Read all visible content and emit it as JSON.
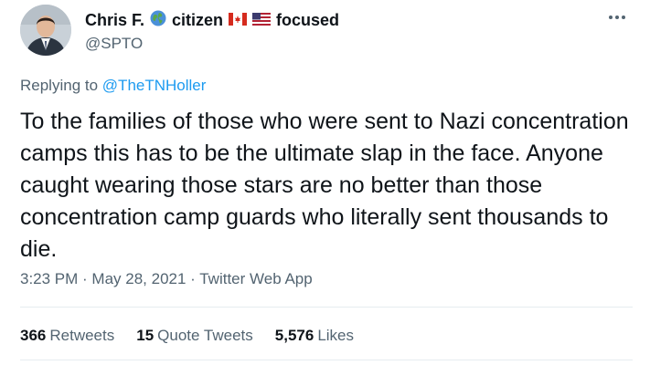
{
  "author": {
    "name": "Chris F.",
    "bio_word_1": "citizen",
    "bio_word_2": "focused",
    "handle": "@SPTO",
    "icons": [
      "globe-icon",
      "canada-flag-icon",
      "us-flag-icon"
    ]
  },
  "reply": {
    "prefix": "Replying to",
    "mention": "@TheTNHoller"
  },
  "tweet": {
    "text": "To the families of those who were sent to Nazi concentration camps this has to be the ultimate slap in the face. Anyone caught wearing those stars are no better than those concentration camp guards who literally sent thousands to die.",
    "timestamp": "3:23 PM · May 28, 2021 · Twitter Web App"
  },
  "stats": {
    "retweets_count": "366",
    "retweets_label": "Retweets",
    "quote_count": "15",
    "quote_label": "Quote Tweets",
    "likes_count": "5,576",
    "likes_label": "Likes"
  },
  "colors": {
    "text": "#0f1419",
    "secondary": "#536471",
    "link": "#1d9bf0",
    "divider": "#e6ecf0"
  }
}
